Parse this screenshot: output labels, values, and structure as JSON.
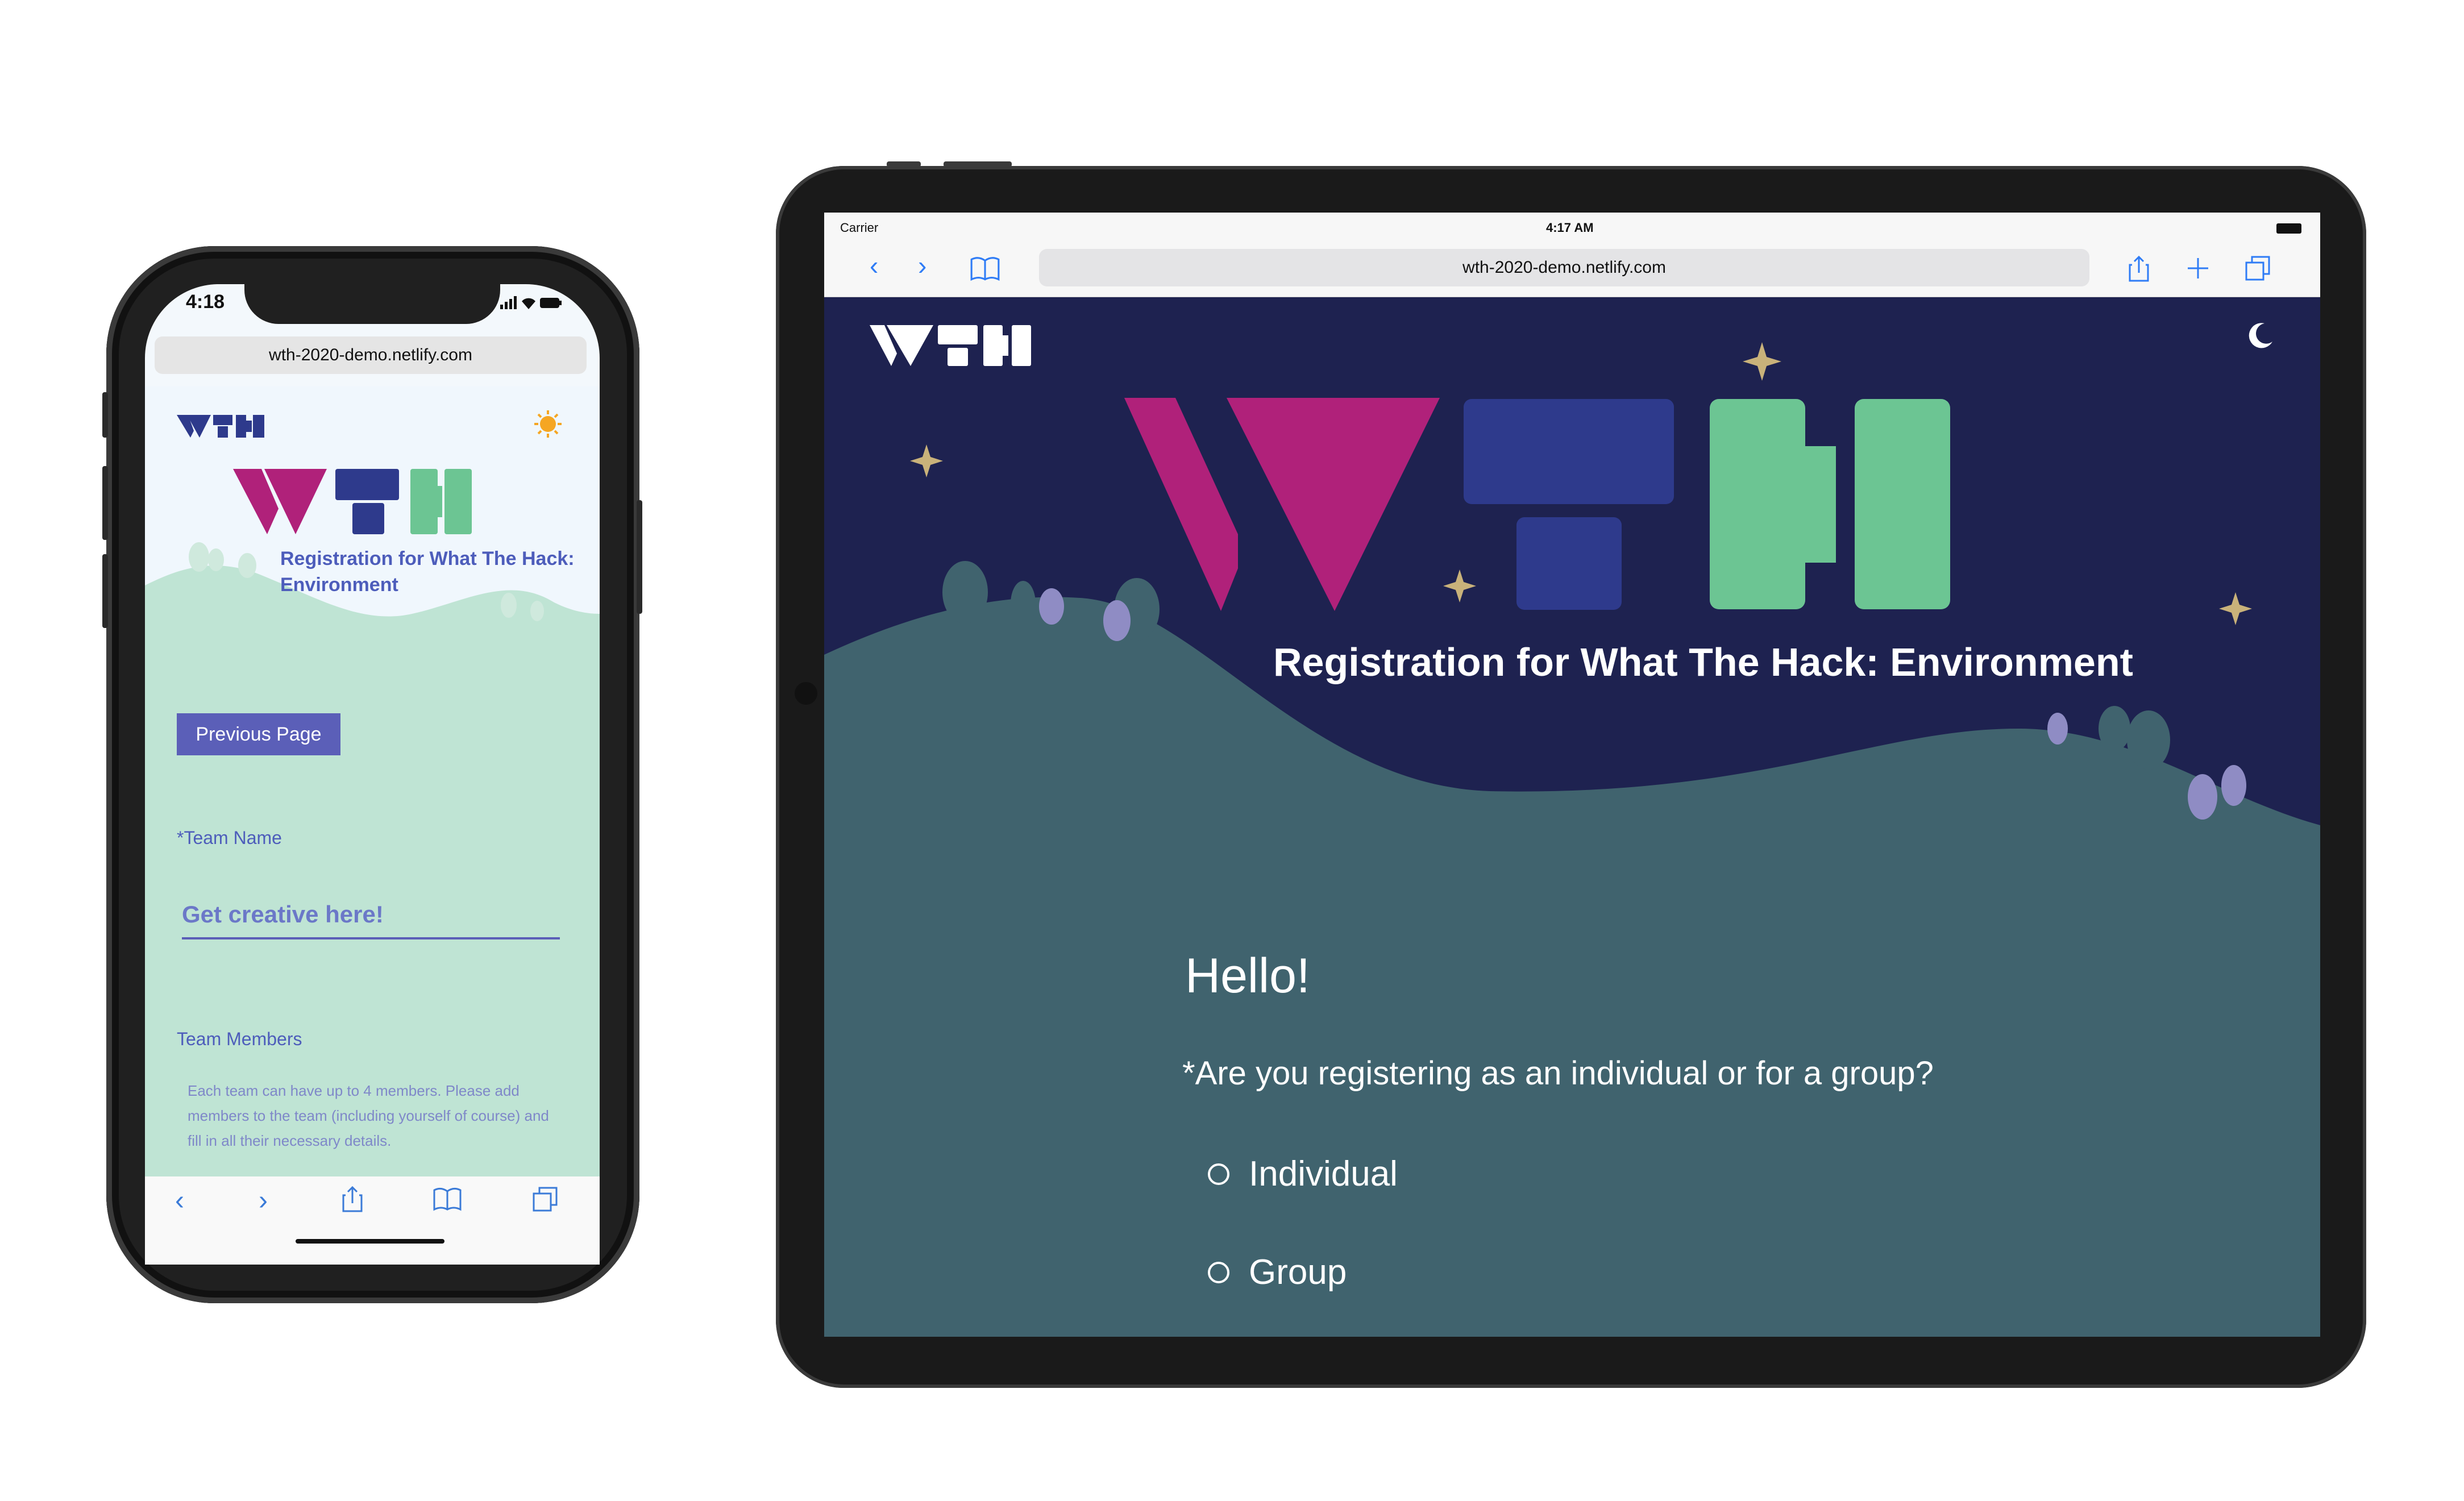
{
  "site_url": "wth-2020-demo.netlify.com",
  "colors": {
    "logo_magenta": "#b0217a",
    "logo_navy": "#2e3a8c",
    "logo_green": "#6cc593",
    "night_sky": "#1e2250",
    "hill_dark": "#40636e",
    "hill_light": "#bfe4d4",
    "accent_purple": "#5b5fb8",
    "safari_blue": "#2f7cf6"
  },
  "phone": {
    "status_time": "4:18",
    "status_icons": "signal-wifi-battery-icons",
    "theme_toggle_icon": "sun-icon",
    "heading": "Registration for What The Hack: Environment",
    "previous_page_label": "Previous Page",
    "team_name_label": "*Team Name",
    "team_name_placeholder": "Get creative here!",
    "team_members_label": "Team Members",
    "team_members_description": "Each team can have up to 4 members. Please add members to the team (including yourself of course) and fill in all their necessary details.",
    "toolbar_icons": [
      "back-icon",
      "forward-icon",
      "share-icon",
      "bookmarks-icon",
      "tabs-icon"
    ]
  },
  "tablet": {
    "carrier": "Carrier",
    "status_time": "4:17 AM",
    "theme_toggle_icon": "moon-icon",
    "heading": "Registration for What The Hack: Environment",
    "greeting": "Hello!",
    "question": "*Are you registering as an individual or for a group?",
    "options": [
      "Individual",
      "Group"
    ],
    "toolbar_icons": [
      "back-icon",
      "forward-icon",
      "bookmarks-icon",
      "share-icon",
      "new-tab-icon",
      "tabs-icon"
    ]
  }
}
